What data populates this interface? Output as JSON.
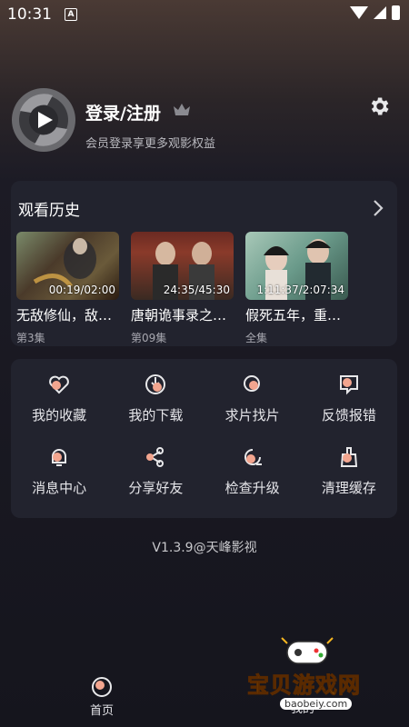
{
  "status_bar": {
    "time": "10:31",
    "notification_letter": "A"
  },
  "profile": {
    "title": "登录/注册",
    "subtitle": "会员登录享更多观影权益",
    "icons": [
      "avatar-icon",
      "crown-icon",
      "gear-icon"
    ]
  },
  "history": {
    "title": "观看历史",
    "items": [
      {
        "title": "无敌修仙，敌…",
        "progress": "00:19/02:00",
        "episode": "第3集"
      },
      {
        "title": "唐朝诡事录之…",
        "progress": "24:35/45:30",
        "episode": "第09集"
      },
      {
        "title": "假死五年，重…",
        "progress": "1:11:37/2:07:34",
        "episode": "全集"
      }
    ]
  },
  "menu": {
    "items": [
      {
        "label": "我的收藏",
        "icon": "heart-icon"
      },
      {
        "label": "我的下载",
        "icon": "download-icon"
      },
      {
        "label": "求片找片",
        "icon": "search-request-icon"
      },
      {
        "label": "反馈报错",
        "icon": "feedback-icon"
      },
      {
        "label": "消息中心",
        "icon": "bell-icon"
      },
      {
        "label": "分享好友",
        "icon": "share-icon"
      },
      {
        "label": "检查升级",
        "icon": "upgrade-icon"
      },
      {
        "label": "清理缓存",
        "icon": "broom-icon"
      }
    ]
  },
  "version": "V1.3.9@天峰影视",
  "tabs": {
    "home": "首页",
    "mine": "我的"
  },
  "watermark": {
    "text": "宝贝游戏网",
    "url": "baobeiy.com"
  },
  "colors": {
    "accent": "#f2a58f",
    "card": "#22232e",
    "background": "#15151d"
  }
}
